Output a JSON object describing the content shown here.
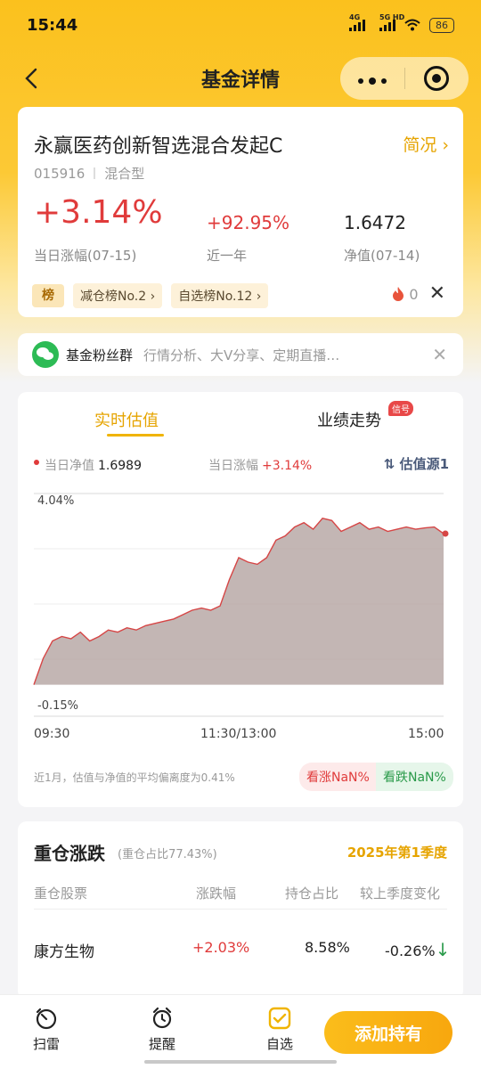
{
  "status_bar": {
    "time": "15:44",
    "signal_1_label": "4G",
    "signal_2_label": "5G HD",
    "battery": "86"
  },
  "nav": {
    "title": "基金详情"
  },
  "fund": {
    "name": "永赢医药创新智选混合发起C",
    "brief_label": "简况",
    "code": "015916",
    "type": "混合型",
    "daily_change": "+3.14%",
    "daily_change_label": "当日涨幅(07-15)",
    "year_change": "+92.95%",
    "year_change_label": "近一年",
    "nav": "1.6472",
    "nav_label": "净值(07-14)",
    "rank_icon": "榜",
    "rank_tags": [
      "减仓榜No.2",
      "自选榜No.12"
    ],
    "hot_count": "0"
  },
  "fans": {
    "title": "基金粉丝群",
    "desc": "行情分析、大V分享、定期直播…"
  },
  "chart_section": {
    "tab_live": "实时估值",
    "tab_perf": "业绩走势",
    "signal_badge": "信号",
    "nav_label": "当日净值",
    "nav_value": "1.6989",
    "change_label": "当日涨幅",
    "change_value": "+3.14%",
    "source": "估值源1",
    "time_labels": [
      "09:30",
      "11:30/13:00",
      "15:00"
    ],
    "deviation_note": "近1月，估值与净值的平均偏离度为0.41%",
    "vote_up": "看涨NaN%",
    "vote_down": "看跌NaN%"
  },
  "chart_data": {
    "type": "area",
    "title": "",
    "xlabel": "",
    "ylabel": "",
    "x_labels": [
      "09:30",
      "11:30/13:00",
      "15:00"
    ],
    "y_labels": [
      "4.04%",
      "-0.15%"
    ],
    "ylim": [
      -0.15,
      4.04
    ],
    "grid": true,
    "colors": {
      "line": "#d64545",
      "fill": "#b8a9a7"
    },
    "series": [
      {
        "name": "",
        "values": [
          0.0,
          0.6,
          1.0,
          1.1,
          1.05,
          1.2,
          1.0,
          1.1,
          1.25,
          1.2,
          1.3,
          1.25,
          1.35,
          1.4,
          1.45,
          1.5,
          1.6,
          1.7,
          1.75,
          1.7,
          1.8,
          2.4,
          2.9,
          2.8,
          2.75,
          2.9,
          3.3,
          3.4,
          3.6,
          3.7,
          3.55,
          3.8,
          3.75,
          3.5,
          3.6,
          3.7,
          3.55,
          3.6,
          3.5,
          3.55,
          3.6,
          3.55,
          3.58,
          3.6,
          3.45
        ]
      }
    ]
  },
  "holdings": {
    "title": "重仓涨跌",
    "ratio": "(重仓占比77.43%)",
    "quarter": "2025年第1季度",
    "headers": [
      "重仓股票",
      "涨跌幅",
      "持仓占比",
      "较上季度变化"
    ],
    "rows": [
      {
        "name": "康方生物",
        "change": "+2.03%",
        "weight": "8.58%",
        "delta": "-0.26%"
      }
    ]
  },
  "bottom_bar": {
    "items": [
      "扫雷",
      "提醒",
      "自选"
    ],
    "add_button": "添加持有"
  },
  "colors": {
    "accent": "#f0b400",
    "up": "#e03b3b",
    "down": "#2a9a4a"
  }
}
